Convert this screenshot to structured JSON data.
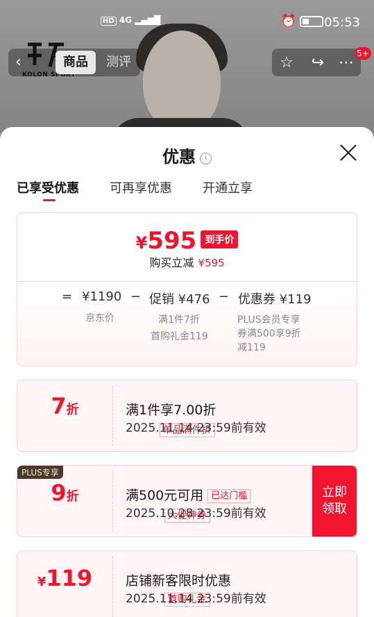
{
  "status_bar": {
    "network": "4G",
    "hd": "HD",
    "time": "05:53"
  },
  "header": {
    "logo_text": "KOLON SPORT",
    "tab_goods": "商品",
    "tab_review": "测评",
    "notification_badge": "5+"
  },
  "sheet": {
    "title": "优惠",
    "tabs": [
      {
        "label": "已享受优惠",
        "active": true
      },
      {
        "label": "可再享优惠",
        "active": false
      },
      {
        "label": "开通立享",
        "active": false
      }
    ],
    "summary": {
      "currency": "¥",
      "final_price": "595",
      "final_tag": "到手价",
      "reduce_label": "购买立减",
      "reduce_amount": "¥595",
      "eq": "=",
      "minus": "−",
      "jd_price": "¥1190",
      "jd_price_label": "京东价",
      "promo_label": "促销",
      "promo_amount": "¥476",
      "promo_sub1": "满1件7折",
      "promo_sub2": "首购礼金119",
      "coupon_label": "优惠券",
      "coupon_amount": "¥119",
      "coupon_sub1": "PLUS会员专享",
      "coupon_sub2": "券满500享9折",
      "coupon_sub3": "减119"
    },
    "coupons": [
      {
        "value": "7",
        "unit": "折",
        "chip": "单品满件折",
        "title": "满1件享7.00折",
        "validity": "2025.11.14 23:59前有效"
      },
      {
        "plus_tag": "PLUS专享",
        "value": "9",
        "unit": "折",
        "chip": "大促神券",
        "title": "满500元可用",
        "threshold": "已达门槛",
        "validity": "2025.10.28 23:59前有效",
        "claim_line1": "立即",
        "claim_line2": "领取"
      },
      {
        "currency": "¥",
        "value": "119",
        "chip": "首购礼金",
        "title": "店铺新客限时优惠",
        "validity": "2025.11.14 23:59前有效"
      }
    ]
  },
  "colors": {
    "accent": "#f0142e",
    "card_bg": "#fff5f6",
    "card_border": "#f8d3d6"
  }
}
